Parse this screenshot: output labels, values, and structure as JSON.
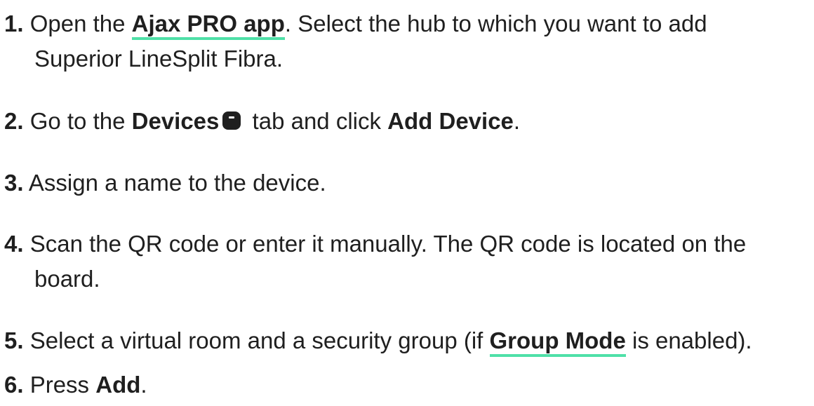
{
  "steps": [
    {
      "number": "1.",
      "text_a": " Open the ",
      "link": "Ajax PRO app",
      "text_b": ". Select the hub to which you want to add",
      "line2": "Superior LineSplit Fibra."
    },
    {
      "number": "2.",
      "text_a": " Go to the ",
      "bold_a": "Devices",
      "icon": "devices-tab-icon",
      "text_b": " tab and click ",
      "bold_b": "Add Device",
      "text_c": "."
    },
    {
      "number": "3.",
      "text_a": " Assign a name to the device."
    },
    {
      "number": "4.",
      "text_a": " Scan the QR code or enter it manually. The QR code is located on the",
      "line2": "board."
    },
    {
      "number": "5.",
      "text_a": " Select a virtual room and a security group (if ",
      "link": "Group Mode",
      "text_b": " is enabled)."
    },
    {
      "number": "6.",
      "text_a": " Press ",
      "bold_a": "Add",
      "text_b": "."
    }
  ],
  "colors": {
    "link_underline": "#4fe0a8",
    "text": "#1f1f1f"
  }
}
